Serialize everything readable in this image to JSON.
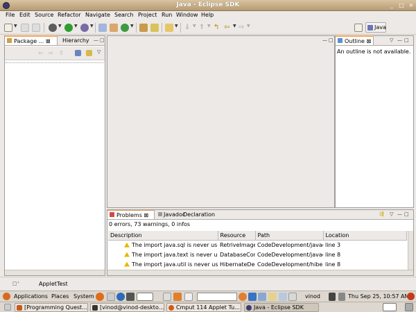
{
  "window": {
    "title": "Java - Eclipse SDK"
  },
  "menu": [
    "File",
    "Edit",
    "Source",
    "Refactor",
    "Navigate",
    "Search",
    "Project",
    "Run",
    "Window",
    "Help"
  ],
  "perspective": {
    "label": "Java"
  },
  "left_panel": {
    "tabs": [
      "Package ...",
      "Hierarchy"
    ]
  },
  "outline": {
    "tab": "Outline",
    "message": "An outline is not available."
  },
  "bottom_panel": {
    "tabs": [
      "Problems",
      "Javadoc",
      "Declaration"
    ],
    "status": "0 errors, 73 warnings, 0 infos",
    "columns": [
      "Description",
      "Resource",
      "Path",
      "Location"
    ],
    "rows": [
      {
        "description": "The import java.sql is never used",
        "resource": "RetriveImage...",
        "path": "CodeDevelopment/javacc",
        "location": "line 3"
      },
      {
        "description": "The import java.text is never use",
        "resource": "DatabaseCon",
        "path": "CodeDevelopment/javacc",
        "location": "line 8"
      },
      {
        "description": "The import java.util is never usec",
        "resource": "HibernateDel",
        "path": "CodeDevelopment/hiberr",
        "location": "line 8"
      }
    ]
  },
  "status_bar": {
    "item": "AppletTest"
  },
  "gnome_panel": {
    "menus": [
      "Applications",
      "Places",
      "System"
    ],
    "user": "vinod",
    "clock": "Thu Sep 25, 10:57 AM"
  },
  "taskbar": [
    {
      "label": "[Programming Quest...",
      "color": "#c65a1e"
    },
    {
      "label": "[vinod@vinod-deskto...",
      "color": "#333333"
    },
    {
      "label": "Cmput 114 Applet Tu...",
      "color": "#d05b1a"
    },
    {
      "label": "Java - Eclipse SDK",
      "color": "#3b3b73",
      "active": true
    }
  ]
}
